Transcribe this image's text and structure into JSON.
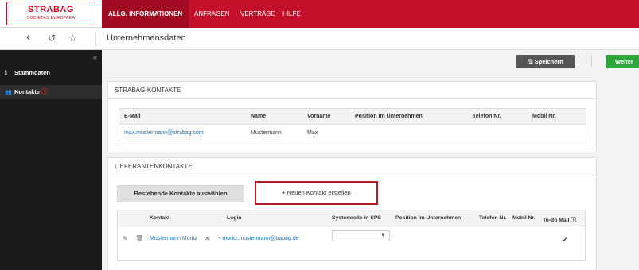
{
  "logo": {
    "line1": "STRABAG",
    "line2": "SOCIETAS EUROPAEA"
  },
  "nav": [
    {
      "label": "ALLG. INFORMATIONEN"
    },
    {
      "label": "ANFRAGEN"
    },
    {
      "label": "VERTRÄGE"
    },
    {
      "label": "HILFE"
    }
  ],
  "subbar": {
    "back": "‹",
    "history": "↺",
    "star": "☆",
    "title": "Unternehmensdaten"
  },
  "sidebar": {
    "collapse": "«",
    "items": [
      {
        "icon": "ℹ",
        "label": "Stammdaten"
      },
      {
        "icon": "👥",
        "label": "Kontakte",
        "warn": "ⓘ"
      }
    ]
  },
  "toolbar": {
    "save_label": "Speichern",
    "save_icon": "🖫",
    "next_label": "Weiter"
  },
  "strabag_contacts": {
    "title": "STRABAG-KONTAKTE",
    "columns": [
      "E-Mail",
      "Name",
      "Vorname",
      "Position im Unternehmen",
      "Telefon Nr.",
      "Mobil Nr."
    ],
    "rows": [
      {
        "email": "max.mustermann@strabag.com",
        "name": "Mustermann",
        "vorname": "Max",
        "position": "",
        "telefon": "",
        "mobil": ""
      }
    ]
  },
  "supplier_contacts": {
    "title": "LIEFERANTENKONTAKTE",
    "tab_existing": "Bestehende Kontakte auswählen",
    "tab_new": "+ Neuen Kontakt erstellen",
    "columns": [
      "Kontakt",
      "Login",
      "Systemrolle in SPS",
      "Position im Unternehmen",
      "Telefon Nr.",
      "Mobil Nr.",
      "To-do Mail ⓘ"
    ],
    "rows": [
      {
        "kontakt": "Mustermann Moritz",
        "login": "moritz.mustermann@bauag.de",
        "systemrolle": "",
        "todo_mail": "✔"
      }
    ]
  },
  "colors": {
    "brand": "#c40f2a",
    "sidebar": "#1b1b1b",
    "save": "#555555",
    "next": "#2ea43a",
    "link": "#1f6fbf"
  }
}
